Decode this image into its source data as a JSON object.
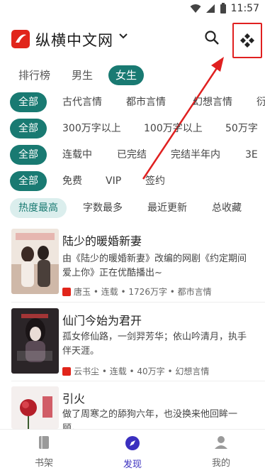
{
  "status": {
    "time": "11:57"
  },
  "header": {
    "title": "纵横中文网"
  },
  "category_tabs": [
    "排行榜",
    "男生",
    "女生"
  ],
  "filters": [
    {
      "all": "全部",
      "options": [
        "古代言情",
        "都市言情",
        "幻想言情",
        "衍"
      ]
    },
    {
      "all": "全部",
      "options": [
        "300万字以上",
        "100万字以上",
        "50万字"
      ]
    },
    {
      "all": "全部",
      "options": [
        "连载中",
        "已完结",
        "完结半年内",
        "3E"
      ]
    },
    {
      "all": "全部",
      "options": [
        "免费",
        "VIP",
        "签约"
      ]
    }
  ],
  "sort": {
    "options": [
      "热度最高",
      "字数最多",
      "最近更新",
      "总收藏"
    ]
  },
  "books": [
    {
      "title": "陆少的暖婚新妻",
      "desc": "由《陆少的暖婚新妻》改编的网剧《约定期间爱上你》正在优酷播出~",
      "meta": "唐玉 • 连载 • 1726万字 • 都市言情"
    },
    {
      "title": "仙门今始为君开",
      "desc": "孤女修仙路，一剑羿芳华；依山吟清月，执手伴天涯。",
      "meta": "云书尘 • 连载 • 40万字 • 幻想言情"
    },
    {
      "title": "引火",
      "desc": "做了周寒之的舔狗六年，也没换来他回眸一顾。",
      "meta": ""
    }
  ],
  "bottom_nav": [
    "书架",
    "发现",
    "我的"
  ],
  "colors": {
    "accent": "#197a72",
    "brand": "#e1251b",
    "nav_active": "#3a2fbf",
    "annotation": "#e02020"
  }
}
